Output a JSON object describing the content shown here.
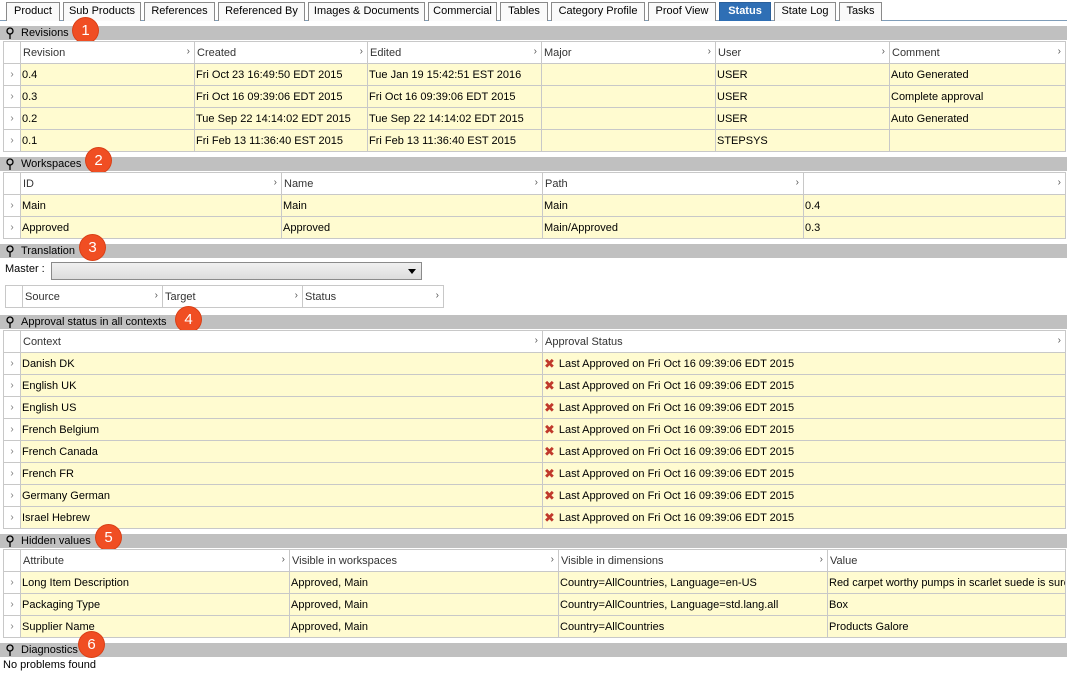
{
  "tabs": [
    "Product",
    "Sub Products",
    "References",
    "Referenced By",
    "Images & Documents",
    "Commercial",
    "Tables",
    "Category Profile",
    "Proof View",
    "Status",
    "State Log",
    "Tasks"
  ],
  "active_tab": "Status",
  "badges": [
    "1",
    "2",
    "3",
    "4",
    "5",
    "6"
  ],
  "revisions": {
    "title": "Revisions",
    "columns": [
      "Revision",
      "Created",
      "Edited",
      "Major",
      "User",
      "Comment"
    ],
    "rows": [
      [
        "0.4",
        "Fri Oct 23 16:49:50 EDT 2015",
        "Tue Jan 19 15:42:51 EST 2016",
        "",
        "USER",
        "Auto Generated"
      ],
      [
        "0.3",
        "Fri Oct 16 09:39:06 EDT 2015",
        "Fri Oct 16 09:39:06 EDT 2015",
        "",
        "USER",
        "Complete approval"
      ],
      [
        "0.2",
        "Tue Sep 22 14:14:02 EDT 2015",
        "Tue Sep 22 14:14:02 EDT 2015",
        "",
        "USER",
        "Auto Generated"
      ],
      [
        "0.1",
        "Fri Feb 13 11:36:40 EST 2015",
        "Fri Feb 13 11:36:40 EST 2015",
        "",
        "STEPSYS",
        ""
      ]
    ]
  },
  "workspaces": {
    "title": "Workspaces",
    "columns": [
      "ID",
      "Name",
      "Path",
      ""
    ],
    "rows": [
      [
        "Main",
        "Main",
        "Main",
        "0.4"
      ],
      [
        "Approved",
        "Approved",
        "Main/Approved",
        "0.3"
      ]
    ]
  },
  "translation": {
    "title": "Translation",
    "master_label": "Master :",
    "master_value": "",
    "columns": [
      "Source",
      "Target",
      "Status"
    ]
  },
  "approval": {
    "title": "Approval status in all contexts",
    "columns": [
      "Context",
      "Approval Status"
    ],
    "rows": [
      [
        "Danish DK",
        "Last Approved on Fri Oct 16 09:39:06 EDT 2015"
      ],
      [
        "English UK",
        "Last Approved on Fri Oct 16 09:39:06 EDT 2015"
      ],
      [
        "English US",
        "Last Approved on Fri Oct 16 09:39:06 EDT 2015"
      ],
      [
        "French Belgium",
        "Last Approved on Fri Oct 16 09:39:06 EDT 2015"
      ],
      [
        "French Canada",
        "Last Approved on Fri Oct 16 09:39:06 EDT 2015"
      ],
      [
        "French FR",
        "Last Approved on Fri Oct 16 09:39:06 EDT 2015"
      ],
      [
        "Germany German",
        "Last Approved on Fri Oct 16 09:39:06 EDT 2015"
      ],
      [
        "Israel Hebrew",
        "Last Approved on Fri Oct 16 09:39:06 EDT 2015"
      ]
    ]
  },
  "hidden": {
    "title": "Hidden values",
    "columns": [
      "Attribute",
      "Visible in workspaces",
      "Visible in dimensions",
      "Value"
    ],
    "rows": [
      [
        "Long Item Description",
        "Approved, Main",
        "Country=AllCountries, Language=en-US",
        "Red carpet worthy pumps in scarlet suede is sure"
      ],
      [
        "Packaging Type",
        "Approved, Main",
        "Country=AllCountries, Language=std.lang.all",
        "Box"
      ],
      [
        "Supplier Name",
        "Approved, Main",
        "Country=AllCountries",
        "Products Galore"
      ]
    ]
  },
  "diagnostics": {
    "title": "Diagnostics",
    "text": "No problems found"
  },
  "icons": {
    "section": "pin-icon",
    "status": "x-icon",
    "row": "chevron-right-icon",
    "column": "chevron-right-icon"
  },
  "colors": {
    "row_bg": "#fffbd0",
    "section_bg": "#c0c0c0",
    "active_tab": "#2f6fb5",
    "badge": "#f04e23",
    "error": "#c0392b"
  }
}
